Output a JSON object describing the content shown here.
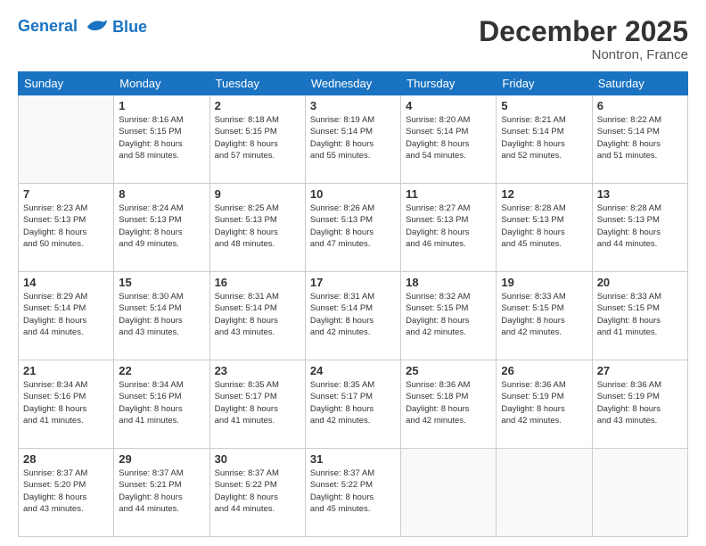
{
  "header": {
    "logo_line1": "General",
    "logo_line2": "Blue",
    "month_title": "December 2025",
    "location": "Nontron, France"
  },
  "days_of_week": [
    "Sunday",
    "Monday",
    "Tuesday",
    "Wednesday",
    "Thursday",
    "Friday",
    "Saturday"
  ],
  "weeks": [
    [
      {
        "day": "",
        "sunrise": "",
        "sunset": "",
        "daylight": ""
      },
      {
        "day": "1",
        "sunrise": "Sunrise: 8:16 AM",
        "sunset": "Sunset: 5:15 PM",
        "daylight": "Daylight: 8 hours and 58 minutes."
      },
      {
        "day": "2",
        "sunrise": "Sunrise: 8:18 AM",
        "sunset": "Sunset: 5:15 PM",
        "daylight": "Daylight: 8 hours and 57 minutes."
      },
      {
        "day": "3",
        "sunrise": "Sunrise: 8:19 AM",
        "sunset": "Sunset: 5:14 PM",
        "daylight": "Daylight: 8 hours and 55 minutes."
      },
      {
        "day": "4",
        "sunrise": "Sunrise: 8:20 AM",
        "sunset": "Sunset: 5:14 PM",
        "daylight": "Daylight: 8 hours and 54 minutes."
      },
      {
        "day": "5",
        "sunrise": "Sunrise: 8:21 AM",
        "sunset": "Sunset: 5:14 PM",
        "daylight": "Daylight: 8 hours and 52 minutes."
      },
      {
        "day": "6",
        "sunrise": "Sunrise: 8:22 AM",
        "sunset": "Sunset: 5:14 PM",
        "daylight": "Daylight: 8 hours and 51 minutes."
      }
    ],
    [
      {
        "day": "7",
        "sunrise": "Sunrise: 8:23 AM",
        "sunset": "Sunset: 5:13 PM",
        "daylight": "Daylight: 8 hours and 50 minutes."
      },
      {
        "day": "8",
        "sunrise": "Sunrise: 8:24 AM",
        "sunset": "Sunset: 5:13 PM",
        "daylight": "Daylight: 8 hours and 49 minutes."
      },
      {
        "day": "9",
        "sunrise": "Sunrise: 8:25 AM",
        "sunset": "Sunset: 5:13 PM",
        "daylight": "Daylight: 8 hours and 48 minutes."
      },
      {
        "day": "10",
        "sunrise": "Sunrise: 8:26 AM",
        "sunset": "Sunset: 5:13 PM",
        "daylight": "Daylight: 8 hours and 47 minutes."
      },
      {
        "day": "11",
        "sunrise": "Sunrise: 8:27 AM",
        "sunset": "Sunset: 5:13 PM",
        "daylight": "Daylight: 8 hours and 46 minutes."
      },
      {
        "day": "12",
        "sunrise": "Sunrise: 8:28 AM",
        "sunset": "Sunset: 5:13 PM",
        "daylight": "Daylight: 8 hours and 45 minutes."
      },
      {
        "day": "13",
        "sunrise": "Sunrise: 8:28 AM",
        "sunset": "Sunset: 5:13 PM",
        "daylight": "Daylight: 8 hours and 44 minutes."
      }
    ],
    [
      {
        "day": "14",
        "sunrise": "Sunrise: 8:29 AM",
        "sunset": "Sunset: 5:14 PM",
        "daylight": "Daylight: 8 hours and 44 minutes."
      },
      {
        "day": "15",
        "sunrise": "Sunrise: 8:30 AM",
        "sunset": "Sunset: 5:14 PM",
        "daylight": "Daylight: 8 hours and 43 minutes."
      },
      {
        "day": "16",
        "sunrise": "Sunrise: 8:31 AM",
        "sunset": "Sunset: 5:14 PM",
        "daylight": "Daylight: 8 hours and 43 minutes."
      },
      {
        "day": "17",
        "sunrise": "Sunrise: 8:31 AM",
        "sunset": "Sunset: 5:14 PM",
        "daylight": "Daylight: 8 hours and 42 minutes."
      },
      {
        "day": "18",
        "sunrise": "Sunrise: 8:32 AM",
        "sunset": "Sunset: 5:15 PM",
        "daylight": "Daylight: 8 hours and 42 minutes."
      },
      {
        "day": "19",
        "sunrise": "Sunrise: 8:33 AM",
        "sunset": "Sunset: 5:15 PM",
        "daylight": "Daylight: 8 hours and 42 minutes."
      },
      {
        "day": "20",
        "sunrise": "Sunrise: 8:33 AM",
        "sunset": "Sunset: 5:15 PM",
        "daylight": "Daylight: 8 hours and 41 minutes."
      }
    ],
    [
      {
        "day": "21",
        "sunrise": "Sunrise: 8:34 AM",
        "sunset": "Sunset: 5:16 PM",
        "daylight": "Daylight: 8 hours and 41 minutes."
      },
      {
        "day": "22",
        "sunrise": "Sunrise: 8:34 AM",
        "sunset": "Sunset: 5:16 PM",
        "daylight": "Daylight: 8 hours and 41 minutes."
      },
      {
        "day": "23",
        "sunrise": "Sunrise: 8:35 AM",
        "sunset": "Sunset: 5:17 PM",
        "daylight": "Daylight: 8 hours and 41 minutes."
      },
      {
        "day": "24",
        "sunrise": "Sunrise: 8:35 AM",
        "sunset": "Sunset: 5:17 PM",
        "daylight": "Daylight: 8 hours and 42 minutes."
      },
      {
        "day": "25",
        "sunrise": "Sunrise: 8:36 AM",
        "sunset": "Sunset: 5:18 PM",
        "daylight": "Daylight: 8 hours and 42 minutes."
      },
      {
        "day": "26",
        "sunrise": "Sunrise: 8:36 AM",
        "sunset": "Sunset: 5:19 PM",
        "daylight": "Daylight: 8 hours and 42 minutes."
      },
      {
        "day": "27",
        "sunrise": "Sunrise: 8:36 AM",
        "sunset": "Sunset: 5:19 PM",
        "daylight": "Daylight: 8 hours and 43 minutes."
      }
    ],
    [
      {
        "day": "28",
        "sunrise": "Sunrise: 8:37 AM",
        "sunset": "Sunset: 5:20 PM",
        "daylight": "Daylight: 8 hours and 43 minutes."
      },
      {
        "day": "29",
        "sunrise": "Sunrise: 8:37 AM",
        "sunset": "Sunset: 5:21 PM",
        "daylight": "Daylight: 8 hours and 44 minutes."
      },
      {
        "day": "30",
        "sunrise": "Sunrise: 8:37 AM",
        "sunset": "Sunset: 5:22 PM",
        "daylight": "Daylight: 8 hours and 44 minutes."
      },
      {
        "day": "31",
        "sunrise": "Sunrise: 8:37 AM",
        "sunset": "Sunset: 5:22 PM",
        "daylight": "Daylight: 8 hours and 45 minutes."
      },
      {
        "day": "",
        "sunrise": "",
        "sunset": "",
        "daylight": ""
      },
      {
        "day": "",
        "sunrise": "",
        "sunset": "",
        "daylight": ""
      },
      {
        "day": "",
        "sunrise": "",
        "sunset": "",
        "daylight": ""
      }
    ]
  ]
}
